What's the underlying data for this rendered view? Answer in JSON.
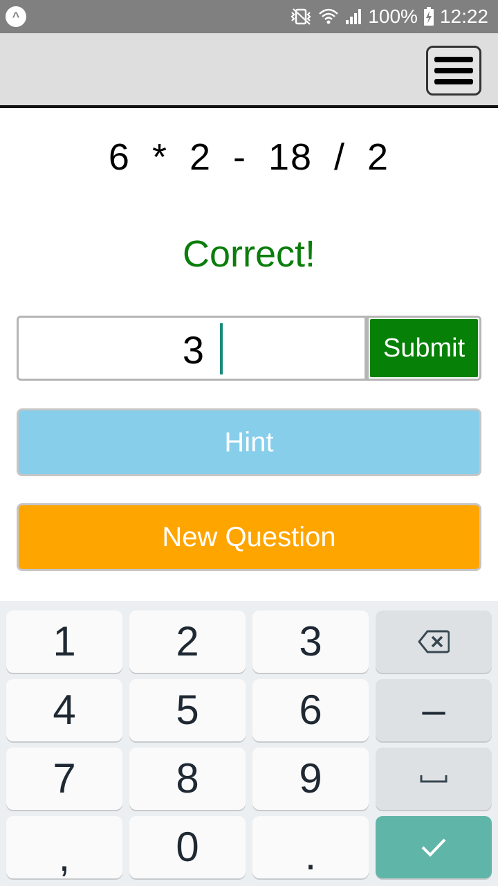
{
  "status_bar": {
    "battery": "100%",
    "time": "12:22",
    "icons": [
      "app-notification-icon",
      "vibrate-icon",
      "wifi-icon",
      "signal-icon",
      "battery-charging-icon"
    ]
  },
  "app_bar": {
    "menu_icon": "hamburger-menu-icon"
  },
  "question": {
    "expression": "6 * 2 - 18 / 2"
  },
  "feedback": {
    "text": "Correct!",
    "color": "#0a7d0a"
  },
  "answer": {
    "value": "3",
    "submit_label": "Submit",
    "submit_color": "#068006"
  },
  "buttons": {
    "hint_label": "Hint",
    "hint_color": "#87ceeb",
    "new_question_label": "New Question",
    "new_question_color": "#ffa500"
  },
  "keyboard": {
    "keys": [
      "1",
      "2",
      "3",
      "4",
      "5",
      "6",
      "7",
      "8",
      "9",
      ",",
      "0",
      "."
    ],
    "minus_label": "–",
    "icons": [
      "backspace-icon",
      "space-icon",
      "checkmark-icon"
    ],
    "done_color": "#5fb5a8"
  }
}
